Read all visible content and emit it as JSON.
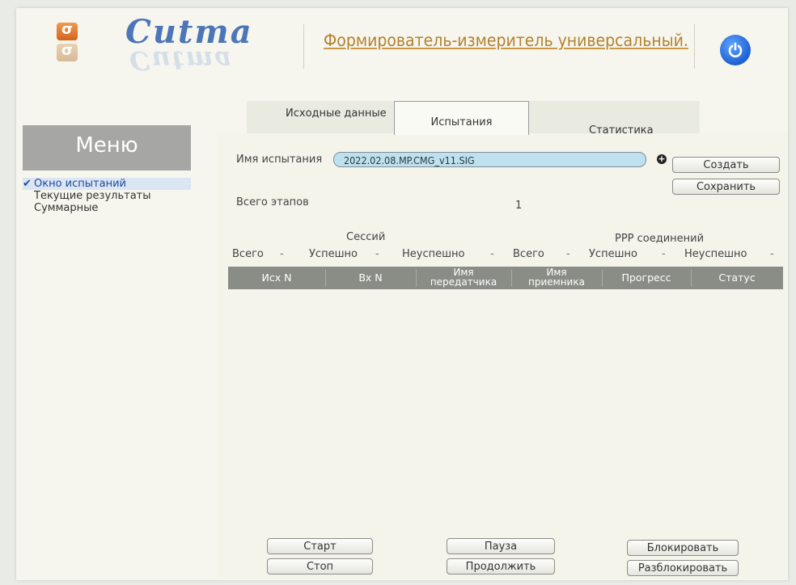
{
  "header": {
    "brand": "Cutma",
    "app_title": "Формирователь-измеритель универсальный."
  },
  "sidebar": {
    "title": "Меню",
    "items": [
      {
        "label": "Окно испытаний",
        "active": true
      },
      {
        "label": "Текущие результаты",
        "active": false
      },
      {
        "label": "Суммарные",
        "active": false
      }
    ]
  },
  "tabs": [
    {
      "label": "Исходные данные"
    },
    {
      "label": "Испытания"
    },
    {
      "label": "Статистика"
    }
  ],
  "test": {
    "name_label": "Имя испытания",
    "name_value": "2022.02.08.MP.CMG_v11.SIG",
    "create_label": "Создать",
    "save_label": "Сохранить",
    "stages_label": "Всего этапов",
    "stages_value": "1"
  },
  "stats": {
    "sessions_label": "Сессий",
    "ppp_label": "РРР соединений",
    "total_label": "Всего",
    "success_label": "Успешно",
    "fail_label": "Неуспешно",
    "total2_label": "Всего",
    "success2_label": "Успешно",
    "fail2_label": "Неуспешно",
    "dash": "-"
  },
  "table": {
    "columns": [
      "Исх N",
      "Вх N",
      "Имя передатчика",
      "Имя приемника",
      "Прогресс",
      "Статус"
    ],
    "col3_line1": "Имя",
    "col3_line2": "передатчика",
    "col4_line1": "Имя",
    "col4_line2": "приемника"
  },
  "controls": {
    "start": "Старт",
    "stop": "Стоп",
    "pause": "Пауза",
    "resume": "Продолжить",
    "lock": "Блокировать",
    "unlock": "Разблокировать"
  },
  "colors": {
    "field_bg": "#bfe0ee",
    "menu_bg": "#a6a6a4",
    "header_title": "#b3822e",
    "power_button": "#1f5fd3"
  }
}
